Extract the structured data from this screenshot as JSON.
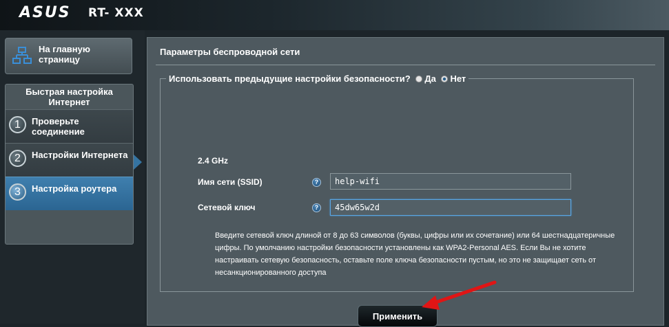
{
  "header": {
    "brand": "ASUS",
    "model": "RT- XXX"
  },
  "sidebar": {
    "home": {
      "label": "На главную страницу",
      "icon": "network-icon"
    },
    "qis_title": "Быстрая настройка Интернет",
    "steps": [
      {
        "num": "1",
        "label": "Проверьте соединение"
      },
      {
        "num": "2",
        "label": "Настройки Интернета"
      },
      {
        "num": "3",
        "label": "Настройка роутера",
        "active": true
      }
    ]
  },
  "main": {
    "title": "Параметры беспроводной сети",
    "security_question": "Использовать предыдущие настройки безопасности?",
    "options": {
      "yes": "Да",
      "no": "Нет",
      "selected": "no"
    },
    "band": "2.4 GHz",
    "ssid": {
      "label": "Имя сети (SSID)",
      "value": "help-wifi"
    },
    "key": {
      "label": "Сетевой ключ",
      "value": "45dw65w2d"
    },
    "help_symbol": "?",
    "hint": "Введите сетевой ключ длиной от 8 до 63 символов (буквы, цифры или их сочетание) или 64 шестнадцатеричные цифры. По умолчанию настройки безопасности установлены как WPA2-Personal AES. Если Вы не хотите настраивать сетевую безопасность, оставьте поле ключа безопасности пустым, но это не защищает сеть от несанкционированного доступа",
    "apply_label": "Применить"
  },
  "colors": {
    "background": "#1c2429",
    "panel": "#4e595f",
    "active_step": "#3574a2",
    "annotation_arrow": "#e01515"
  }
}
